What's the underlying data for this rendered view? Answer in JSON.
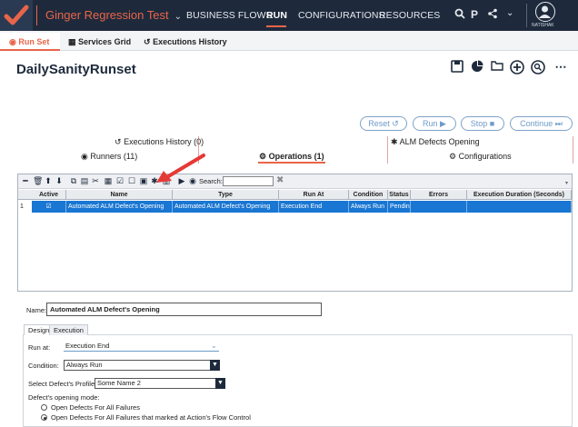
{
  "app": {
    "title": "Ginger Regression Test",
    "nav": [
      "BUSINESS FLOWS",
      "RUN",
      "CONFIGURATIONS",
      "RESOURCES"
    ],
    "active_nav": "RUN",
    "user_name": "NATISHAK",
    "accent": "#e8654a",
    "topbar_color": "#1e2a3c"
  },
  "subtabs": {
    "run_set": "Run Set",
    "services_grid": "Services Grid",
    "executions_history": "Executions History"
  },
  "page": {
    "title": "DailySanityRunset"
  },
  "actions": {
    "reset": "Reset",
    "run": "Run",
    "stop": "Stop",
    "continue": "Continue"
  },
  "runner_tabs": {
    "executions_history": "Executions History (0)",
    "alm_defects": "ALM Defects Opening",
    "runners": "Runners (11)",
    "operations": "Operations (1)",
    "configurations": "Configurations"
  },
  "grid": {
    "search_label": "Search:",
    "columns": [
      "Active",
      "Name",
      "Type",
      "Run At",
      "Condition",
      "Status",
      "Errors",
      "Execution Duration (Seconds)"
    ],
    "rows": [
      {
        "num": "1",
        "active": "☑",
        "name": "Automated ALM Defect's Opening",
        "type": "Automated ALM Defect's Opening",
        "run_at": "Execution End",
        "condition": "Always Run",
        "status": "Pendin",
        "errors": "",
        "duration": ""
      }
    ]
  },
  "details": {
    "name_label": "Name:",
    "name_value": "Automated ALM Defect's Opening",
    "tabs": [
      "Design",
      "Execution"
    ],
    "run_at_label": "Run at:",
    "run_at_value": "Execution End",
    "condition_label": "Condition:",
    "condition_value": "Always Run",
    "profile_label": "Select Defect's Profile:",
    "profile_value": "Some Name 2",
    "mode_label": "Defect's opening mode:",
    "mode_option1": "Open Defects For All Failures",
    "mode_option2": "Open Defects For All Failures that marked at Action's Flow Control",
    "selected_mode": 2
  }
}
